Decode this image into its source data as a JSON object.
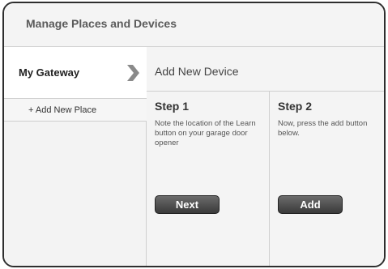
{
  "header": {
    "title": "Manage Places and Devices"
  },
  "sidebar": {
    "gateway_label": "My Gateway",
    "add_place_label": "+ Add New Place"
  },
  "main": {
    "title": "Add New Device",
    "steps": [
      {
        "heading": "Step 1",
        "description": "Note the location of the Learn button on your garage door opener",
        "button_label": "Next"
      },
      {
        "heading": "Step 2",
        "description": "Now, press the add button below.",
        "button_label": "Add"
      }
    ]
  },
  "icons": {
    "gateway_chevron": "chevron-right-icon"
  },
  "colors": {
    "frame_border": "#2e2e2e",
    "button_top": "#6b6b6b",
    "button_bottom": "#3a3a3a",
    "chevron": "#8a8a8a"
  }
}
